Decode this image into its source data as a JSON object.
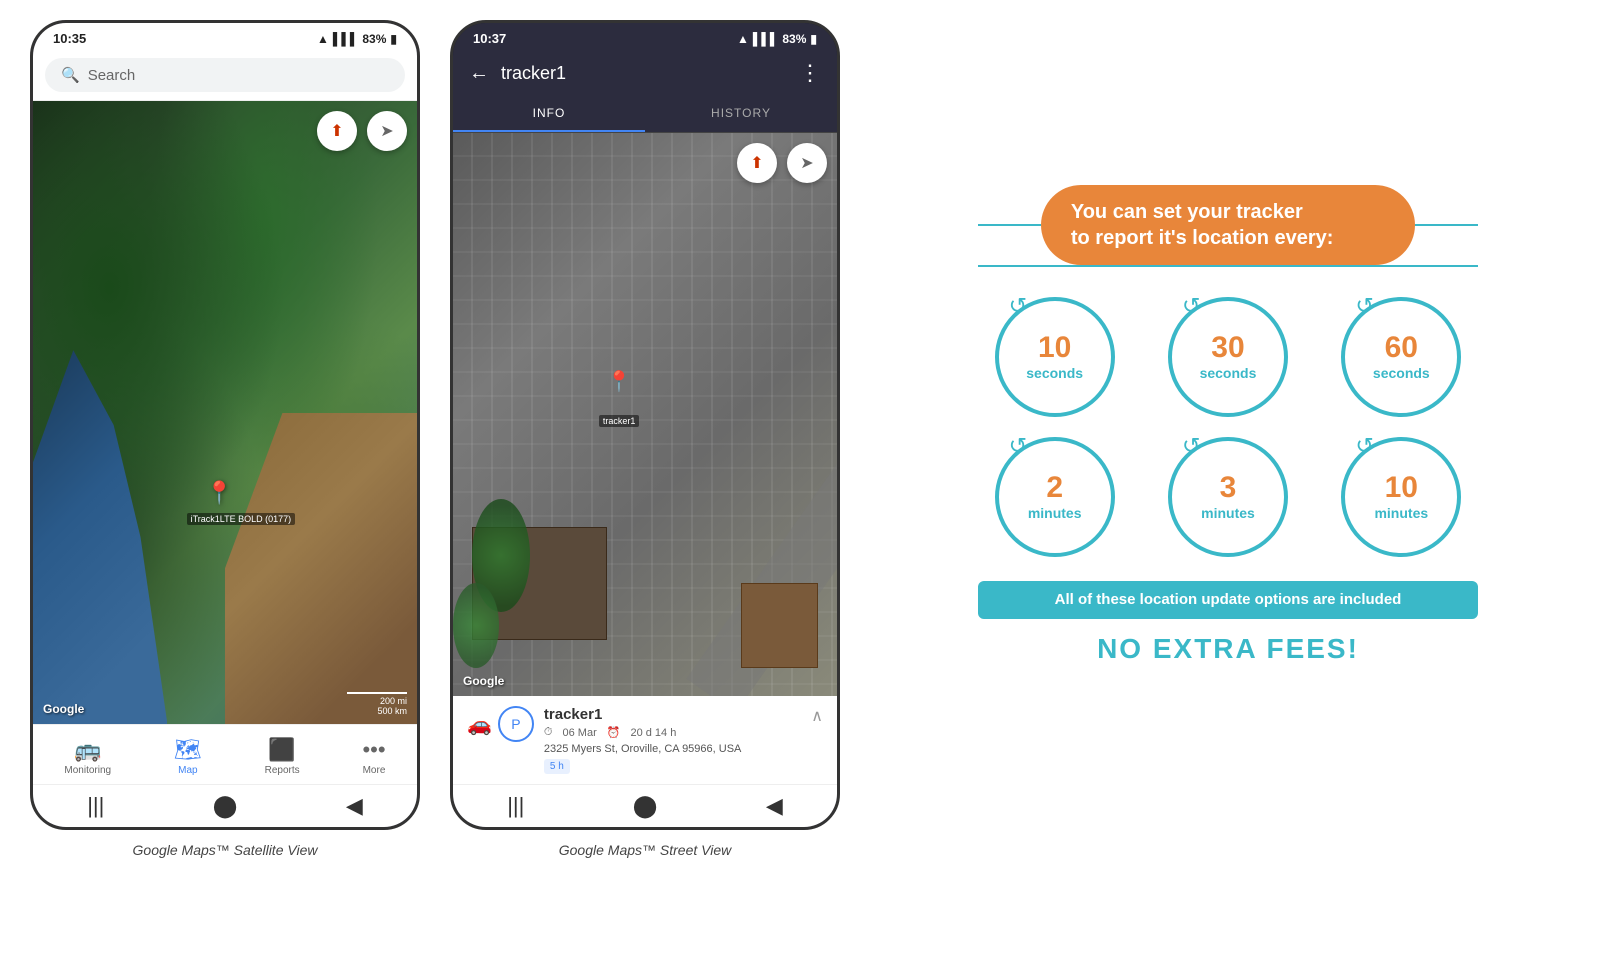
{
  "page": {
    "background": "#ffffff"
  },
  "phone1": {
    "status_bar": {
      "time": "10:35",
      "signal": "▲▼",
      "bars": "▌▌▌",
      "battery": "83%",
      "battery_icon": "🔋"
    },
    "search": {
      "placeholder": "Search"
    },
    "map": {
      "type": "satellite",
      "google_logo": "Google",
      "scale_200mi": "200 mi",
      "scale_500km": "500 km",
      "tracker_label": "iTrack1LTE BOLD (0177)"
    },
    "bottom_nav": {
      "items": [
        {
          "icon": "🚌",
          "label": "Monitoring",
          "active": false
        },
        {
          "icon": "🗺",
          "label": "Map",
          "active": true
        },
        {
          "icon": "⬛",
          "label": "Reports",
          "active": false
        },
        {
          "icon": "•••",
          "label": "More",
          "active": false
        }
      ]
    },
    "android_nav": {
      "buttons": [
        "|||",
        "⬤",
        "◀"
      ]
    },
    "caption": "Google Maps™ Satellite View"
  },
  "phone2": {
    "status_bar": {
      "time": "10:37",
      "battery": "83%"
    },
    "header": {
      "back_icon": "←",
      "title": "tracker1",
      "menu_icon": "⋮"
    },
    "tabs": [
      {
        "label": "INFO",
        "active": true
      },
      {
        "label": "HISTORY",
        "active": false
      }
    ],
    "map": {
      "type": "aerial",
      "google_logo": "Google",
      "tracker_label": "tracker1"
    },
    "tracker_info": {
      "name": "tracker1",
      "date": "06 Mar",
      "duration": "20 d 14 h",
      "address": "2325 Myers St, Oroville, CA 95966, USA",
      "badge": "5 h"
    },
    "android_nav": {
      "buttons": [
        "|||",
        "⬤",
        "◀"
      ]
    },
    "caption": "Google Maps™ Street View"
  },
  "info_panel": {
    "headline": "You can set your tracker\nto report it's location every:",
    "circles": [
      {
        "number": "10",
        "unit": "seconds"
      },
      {
        "number": "30",
        "unit": "seconds"
      },
      {
        "number": "60",
        "unit": "seconds"
      },
      {
        "number": "2",
        "unit": "minutes"
      },
      {
        "number": "3",
        "unit": "minutes"
      },
      {
        "number": "10",
        "unit": "minutes"
      }
    ],
    "fees_banner": "All of these location update options are included",
    "no_extra_fees": "NO EXTRA FEES!"
  }
}
